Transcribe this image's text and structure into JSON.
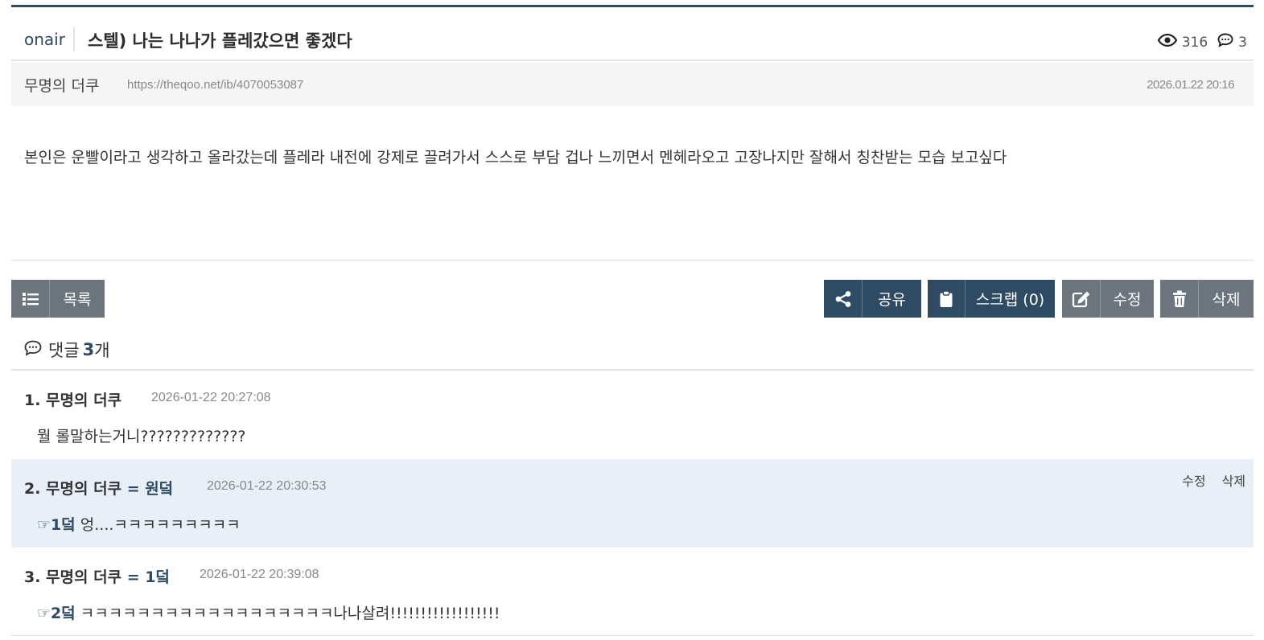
{
  "post": {
    "board": "onair",
    "title": "스텔) 나는 나나가 플레갔으면 좋겠다",
    "views": "316",
    "comments_count": "3",
    "author": "무명의 더쿠",
    "url": "https://theqoo.net/ib/4070053087",
    "date": "2026.01.22 20:16",
    "content": "본인은 운빨이라고 생각하고 올라갔는데 플레라 내전에 강제로 끌려가서 스스로 부담 겁나 느끼면서 멘헤라오고 고장나지만 잘해서 칭찬받는 모습 보고싶다"
  },
  "buttons": {
    "list": "목록",
    "share": "공유",
    "scrap": "스크랩 (0)",
    "edit": "수정",
    "delete": "삭제"
  },
  "comments_header": {
    "label": "댓글",
    "count": "3",
    "suffix": "개"
  },
  "comments": [
    {
      "author": "1. 무명의 더쿠",
      "tag": "",
      "date": "2026-01-22 20:27:08",
      "ref": "",
      "body": "뭘 롤말하는거니?????????????",
      "highlighted": false
    },
    {
      "author": "2. 무명의 더쿠",
      "tag": "= 원덬",
      "date": "2026-01-22 20:30:53",
      "ref": "☞1덬",
      "body": "엉....ㅋㅋㅋㅋㅋㅋㅋㅋㅋ",
      "highlighted": true,
      "edit": "수정",
      "delete": "삭제"
    },
    {
      "author": "3. 무명의 더쿠",
      "tag": "= 1덬",
      "date": "2026-01-22 20:39:08",
      "ref": "☞2덬",
      "body": "ㅋㅋㅋㅋㅋㅋㅋㅋㅋㅋㅋㅋㅋㅋㅋㅋㅋㅋ나나살려!!!!!!!!!!!!!!!!!!",
      "highlighted": false
    }
  ],
  "colors": {
    "navy": "#2f4a63",
    "gray_button": "#6c757d",
    "highlight_bg": "#e8eff6"
  },
  "icons": [
    "eye-icon",
    "speech-bubble-icon",
    "list-icon",
    "share-icon",
    "clipboard-icon",
    "edit-icon",
    "trash-icon"
  ]
}
